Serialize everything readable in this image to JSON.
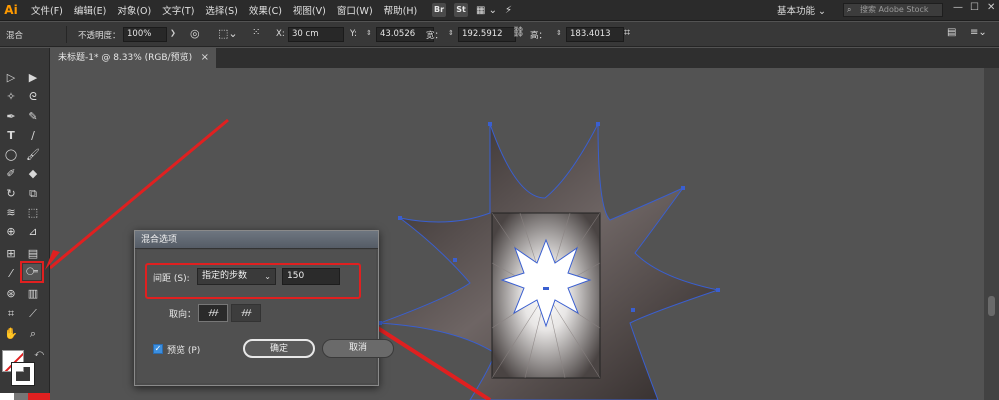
{
  "app": {
    "logo": "Ai",
    "menus": [
      "文件(F)",
      "编辑(E)",
      "对象(O)",
      "文字(T)",
      "选择(S)",
      "效果(C)",
      "视图(V)",
      "窗口(W)",
      "帮助(H)"
    ],
    "menu_icons": [
      "Br",
      "St"
    ],
    "workspace": "基本功能",
    "search_placeholder": "搜索 Adobe Stock"
  },
  "control_bar": {
    "selection_label": "混合",
    "opacity_label": "不透明度：",
    "opacity_value": "100%",
    "x_label": "X:",
    "x_value": "30 cm",
    "y_label": "Y:",
    "y_value": "43.0526",
    "w_label": "宽：",
    "w_value": "192.5912",
    "h_label": "高：",
    "h_value": "183.4013"
  },
  "document": {
    "tab_title": "未标题-1* @ 8.33% (RGB/预览)",
    "tab_close": "×"
  },
  "dialog": {
    "title": "混合选项",
    "spacing_label": "间距 (S):",
    "spacing_mode": "指定的步数",
    "steps_value": "150",
    "orientation_label": "取向：",
    "orientation_glyph_1": "ᚋᚋᚋ",
    "orientation_glyph_2": "ᚋᚋᚋ",
    "preview_label": "预览 (P)",
    "ok_label": "确定",
    "cancel_label": "取消",
    "preview_checked": true
  },
  "colors": {
    "annotation_red": "#e02020",
    "path_blue": "#3a5fd0",
    "shape_dark": "#3a3433"
  }
}
